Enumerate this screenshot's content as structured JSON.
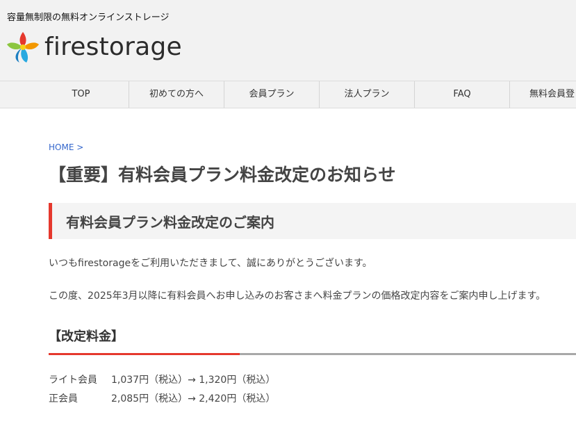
{
  "header": {
    "tagline": "容量無制限の無料オンラインストレージ",
    "logo_text": "firestorage",
    "logo_icon": "flame-flower-icon",
    "brand_colors": [
      "#e5382d",
      "#f39800",
      "#8cc63f",
      "#29a9e0"
    ]
  },
  "nav": {
    "items": [
      {
        "label": "TOP"
      },
      {
        "label": "初めての方へ"
      },
      {
        "label": "会員プラン"
      },
      {
        "label": "法人プラン"
      },
      {
        "label": "FAQ"
      },
      {
        "label": "無料会員登"
      }
    ]
  },
  "breadcrumb": {
    "home": "HOME",
    "separator": ">"
  },
  "page": {
    "title": "【重要】有料会員プラン料金改定のお知らせ",
    "section_heading": "有料会員プラン料金改定のご案内",
    "paragraph1": "いつもfirestorageをご利用いただきまして、誠にありがとうございます。",
    "paragraph2": "この度、2025年3月以降に有料会員へお申し込みのお客さまへ料金プランの価格改定内容をご案内申し上げます。",
    "price_heading": "【改定料金】",
    "accent_color": "#e5382d",
    "prices": [
      {
        "plan": "ライト会員",
        "change": "1,037円（税込）→ 1,320円（税込）"
      },
      {
        "plan": "正会員",
        "change": "2,085円（税込）→ 2,420円（税込）"
      }
    ]
  }
}
